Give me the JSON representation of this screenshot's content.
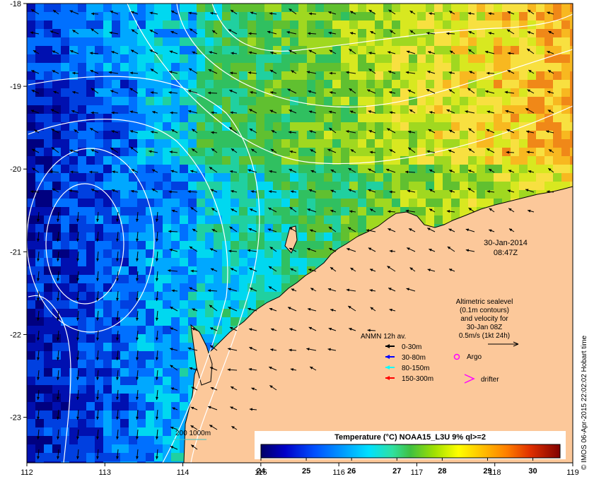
{
  "map": {
    "x_ticks": [
      "112",
      "113",
      "114",
      "115",
      "116",
      "117",
      "118",
      "119"
    ],
    "y_ticks": [
      "-18",
      "-19",
      "-20",
      "-21",
      "-22",
      "-23"
    ],
    "lon_range": [
      112,
      119
    ],
    "lat_range": [
      -23.55,
      -18
    ],
    "land_color": "#fcc89a",
    "contour_color": "#ffffff"
  },
  "datestamp": {
    "date": "30-Jan-2014",
    "time": "08:47Z"
  },
  "altimetry_note": {
    "lines": [
      "Altimetric sealevel",
      "(0.1m contours)",
      "and velocity for",
      "30-Jan 08Z",
      "0.5m/s (1kt 24h)"
    ]
  },
  "anmn_legend": {
    "title": "ANMN 12h av.",
    "items": [
      {
        "label": "0-30m",
        "color": "#000000"
      },
      {
        "label": "30-80m",
        "color": "#0000ff"
      },
      {
        "label": "80-150m",
        "color": "#00ffff"
      },
      {
        "label": "150-300m",
        "color": "#ff0000"
      }
    ]
  },
  "platforms": {
    "argo_label": "Argo",
    "drifter_label": "drifter",
    "marker_color": "#ff00ff"
  },
  "isobath_label": "200  1000m",
  "colorbar": {
    "title": "Temperature (°C) NOAA15_L3U 9% ql>=2",
    "ticks": [
      "24",
      "25",
      "26",
      "27",
      "28",
      "29",
      "30"
    ],
    "range": [
      24,
      30.6
    ]
  },
  "credit": "© IMOS 06-Apr-2015 22:02:02 Hobart time"
}
